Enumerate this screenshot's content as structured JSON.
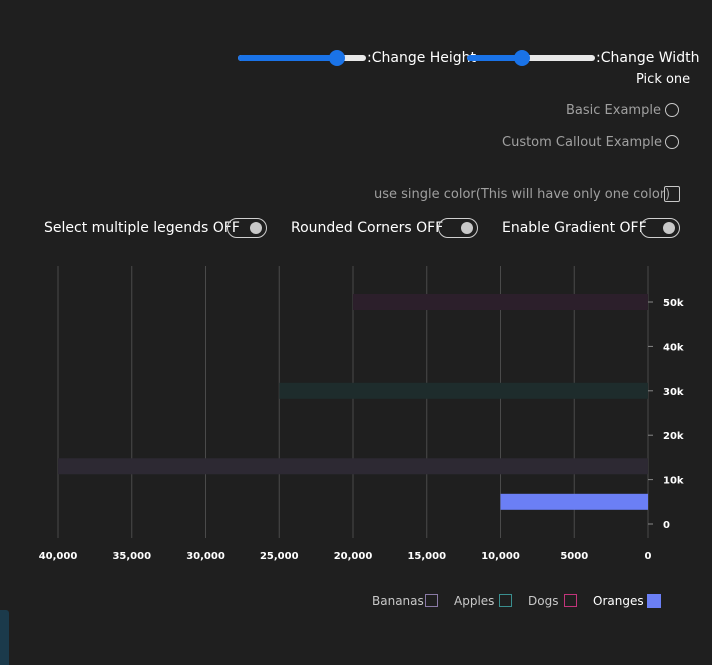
{
  "controls": {
    "change_height_label": ":Change Height",
    "change_width_label": ":Change Width",
    "height_slider_value": 0.78,
    "width_slider_value": 0.43,
    "pick_one_label": "Pick one",
    "radio_options": [
      "Basic Example",
      "Custom Callout Example"
    ],
    "single_color_label": "use single color(This will have only one color)",
    "toggles": {
      "multiple_legends": "Select multiple legends OFF",
      "rounded_corners": "Rounded Corners OFF",
      "gradient": "Enable Gradient OFF"
    }
  },
  "chart_data": {
    "type": "bar",
    "orientation": "horizontal",
    "x_direction": "reversed",
    "xlim": [
      0,
      40000
    ],
    "x_ticks": [
      "40,000",
      "35,000",
      "30,000",
      "25,000",
      "20,000",
      "15,000",
      "10,000",
      "5000",
      "0"
    ],
    "y_ticks": [
      "50k",
      "40k",
      "30k",
      "20k",
      "10k",
      "0"
    ],
    "ylim": [
      0,
      50000
    ],
    "series": [
      {
        "name": "Bananas",
        "y": 13000,
        "x": 40000,
        "color": "#2d2933",
        "border": "#8a7aa6",
        "active": false
      },
      {
        "name": "Apples",
        "y": 30000,
        "x": 25000,
        "color": "#1e2c2c",
        "border": "#3a8f8f",
        "active": false
      },
      {
        "name": "Dogs",
        "y": 50000,
        "x": 20000,
        "color": "#2c1f2b",
        "border": "#c2347a",
        "active": false
      },
      {
        "name": "Oranges",
        "y": 5000,
        "x": 10000,
        "color": "#6b7ff5",
        "border": "#6b7ff5",
        "active": true
      }
    ],
    "legend_placement": "bottom-right",
    "grid": true
  }
}
